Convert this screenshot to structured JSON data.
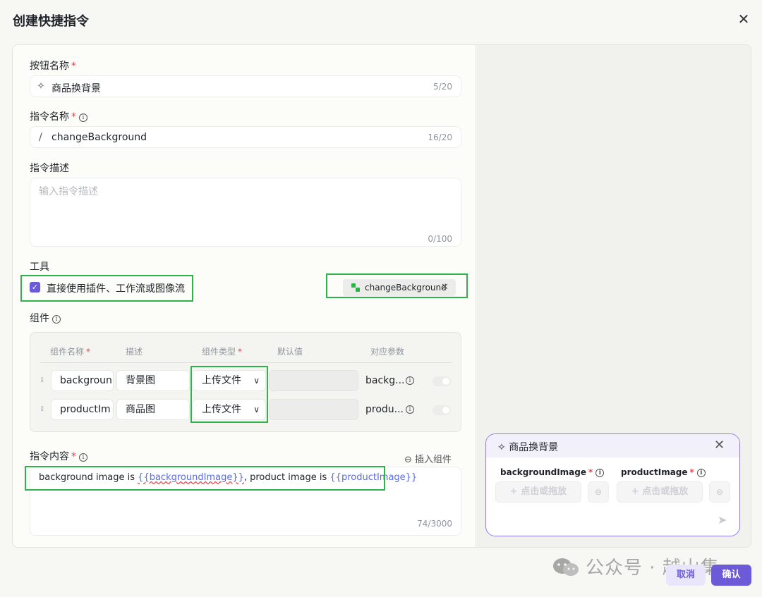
{
  "dialog": {
    "title": "创建快捷指令"
  },
  "button_name": {
    "label": "按钮名称",
    "required_mark": "*",
    "value": "商品换背景",
    "count": "5/20"
  },
  "command_name": {
    "label": "指令名称",
    "required_mark": "*",
    "prefix": "/",
    "value": "changeBackground",
    "count": "16/20"
  },
  "command_desc": {
    "label": "指令描述",
    "placeholder": "输入指令描述",
    "count": "0/100"
  },
  "tools": {
    "label": "工具",
    "checkbox_label": "直接使用插件、工作流或图像流",
    "checked": true,
    "chip_label": "changeBackground"
  },
  "components": {
    "label": "组件",
    "headers": {
      "name": "组件名称",
      "desc": "描述",
      "type": "组件类型",
      "default": "默认值",
      "param": "对应参数"
    },
    "required_mark": "*",
    "rows": [
      {
        "name": "backgroun",
        "desc": "背景图",
        "type": "上传文件",
        "default": "",
        "param": "backg..."
      },
      {
        "name": "productIm",
        "desc": "商品图",
        "type": "上传文件",
        "default": "",
        "param": "produ..."
      }
    ]
  },
  "content": {
    "label": "指令内容",
    "required_mark": "*",
    "insert_label": "插入组件",
    "text_parts": [
      "background image is ",
      "{{backgroundImage}}",
      ", product image is ",
      "{{productImage}}"
    ],
    "count": "74/3000"
  },
  "preview": {
    "title": "商品换背景",
    "fields": [
      {
        "label": "backgroundImage",
        "upload_label": "点击或拖放"
      },
      {
        "label": "productImage",
        "upload_label": "点击或拖放"
      }
    ],
    "required_mark": "*"
  },
  "footer": {
    "cancel_label": "取消",
    "confirm_label": "确认"
  },
  "watermark": {
    "text": "公众号 · 越山集"
  },
  "colors": {
    "accent": "#6b5bd6",
    "highlight_box": "#2db34a",
    "required": "#e5484d",
    "variable": "#5b6cdd"
  }
}
